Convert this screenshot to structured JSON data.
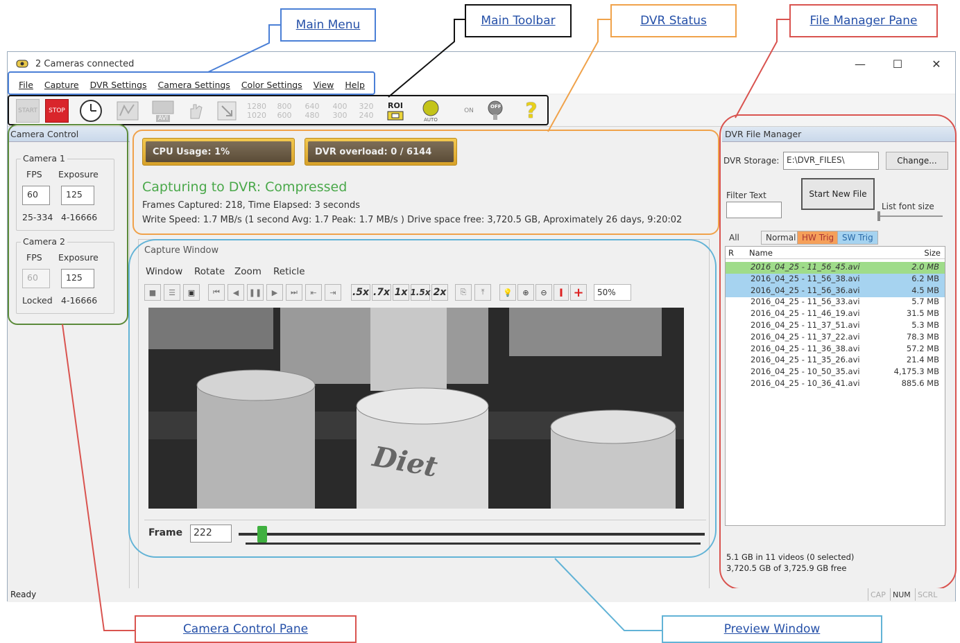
{
  "callouts": {
    "main_menu": "Main Menu",
    "main_toolbar": "Main Toolbar",
    "dvr_status": "DVR Status",
    "file_manager_pane": "File Manager Pane",
    "camera_control_pane": "Camera Control Pane",
    "preview_window": "Preview Window"
  },
  "window": {
    "title": "2 Cameras connected",
    "minimize": "—",
    "maximize": "☐",
    "close": "✕"
  },
  "menu": [
    "File",
    "Capture",
    "DVR Settings",
    "Camera Settings",
    "Color Settings",
    "View",
    "Help"
  ],
  "toolbar": {
    "start": "START",
    "stop": "STOP",
    "avi": "AVI",
    "res_1280": "1280",
    "res_800": "800",
    "res_640": "640",
    "res_400": "400",
    "res_320": "320",
    "res_1020": "1020",
    "res_600": "600",
    "res_480": "480",
    "res_300": "300",
    "res_240": "240",
    "roi": "ROI",
    "auto": "AUTO",
    "on": "ON",
    "off": "OFF",
    "help": "?"
  },
  "camera_control": {
    "title": "Camera Control",
    "camera1": {
      "label": "Camera 1",
      "fps_label": "FPS",
      "exposure_label": "Exposure",
      "fps": "60",
      "exposure": "125",
      "fps_range": "25-334",
      "exposure_range": "4-16666"
    },
    "camera2": {
      "label": "Camera 2",
      "fps_label": "FPS",
      "exposure_label": "Exposure",
      "fps": "60",
      "exposure": "125",
      "fps_range": "Locked",
      "exposure_range": "4-16666"
    }
  },
  "dvr_status": {
    "cpu": "CPU Usage: 1%",
    "overload": "DVR overload: 0 / 6144",
    "headline": "Capturing to DVR: Compressed",
    "line1": "Frames Captured: 218,  Time Elapsed: 3 seconds",
    "line2": "Write Speed: 1.7 MB/s (1 second Avg: 1.7 Peak: 1.7 MB/s )  Drive space free: 3,720.5 GB, Aproximately 26 days, 9:20:02"
  },
  "capture_window": {
    "title": "Capture Window",
    "menu": [
      "Window",
      "Rotate",
      "Zoom",
      "Reticle"
    ],
    "speeds": [
      ".5x",
      ".7x",
      "1x",
      "1.5x",
      "2x"
    ],
    "zoom": "50%",
    "frame_label": "Frame",
    "frame_value": "222",
    "frame_position": 0.04,
    "image_text": "Diet"
  },
  "file_manager": {
    "title": "DVR File Manager",
    "storage_label": "DVR Storage:",
    "storage_path": "E:\\DVR_FILES\\",
    "change": "Change...",
    "filter_label": "Filter Text",
    "start_new_file": "Start New File",
    "font_size_label": "List font size",
    "tabs": [
      "All",
      "Normal",
      "HW Trig",
      "SW Trig"
    ],
    "col_r": "R",
    "col_name": "Name",
    "col_size": "Size",
    "files": [
      {
        "name": "2016_04_25 - 11_56_45.avi",
        "size": "2.0 MB",
        "state": "recording"
      },
      {
        "name": "2016_04_25 - 11_56_38.avi",
        "size": "6.2 MB",
        "state": "selected"
      },
      {
        "name": "2016_04_25 - 11_56_36.avi",
        "size": "4.5 MB",
        "state": "selected"
      },
      {
        "name": "2016_04_25 - 11_56_33.avi",
        "size": "5.7 MB",
        "state": ""
      },
      {
        "name": "2016_04_25 - 11_46_19.avi",
        "size": "31.5 MB",
        "state": ""
      },
      {
        "name": "2016_04_25 - 11_37_51.avi",
        "size": "5.3 MB",
        "state": ""
      },
      {
        "name": "2016_04_25 - 11_37_22.avi",
        "size": "78.3 MB",
        "state": ""
      },
      {
        "name": "2016_04_25 - 11_36_38.avi",
        "size": "57.2 MB",
        "state": ""
      },
      {
        "name": "2016_04_25 - 11_35_26.avi",
        "size": "21.4 MB",
        "state": ""
      },
      {
        "name": "2016_04_25 - 10_50_35.avi",
        "size": "4,175.3 MB",
        "state": ""
      },
      {
        "name": "2016_04_25 - 10_36_41.avi",
        "size": "885.6 MB",
        "state": ""
      }
    ],
    "summary1": "5.1 GB in 11 videos (0 selected)",
    "summary2": "3,720.5 GB of 3,725.9 GB free"
  },
  "status": {
    "ready": "Ready",
    "cap": "CAP",
    "num": "NUM",
    "scrl": "SCRL"
  },
  "colors": {
    "callout_blue": "#4a7fd6",
    "callout_black": "#111111",
    "callout_orange": "#f0a24a",
    "callout_red": "#d9534f",
    "callout_green": "#5b8a3a",
    "callout_cyan": "#62b3d6",
    "dvr_green": "#4aa84a",
    "selected_row": "#a6d3f0",
    "recording_row": "#9fdc8a"
  }
}
